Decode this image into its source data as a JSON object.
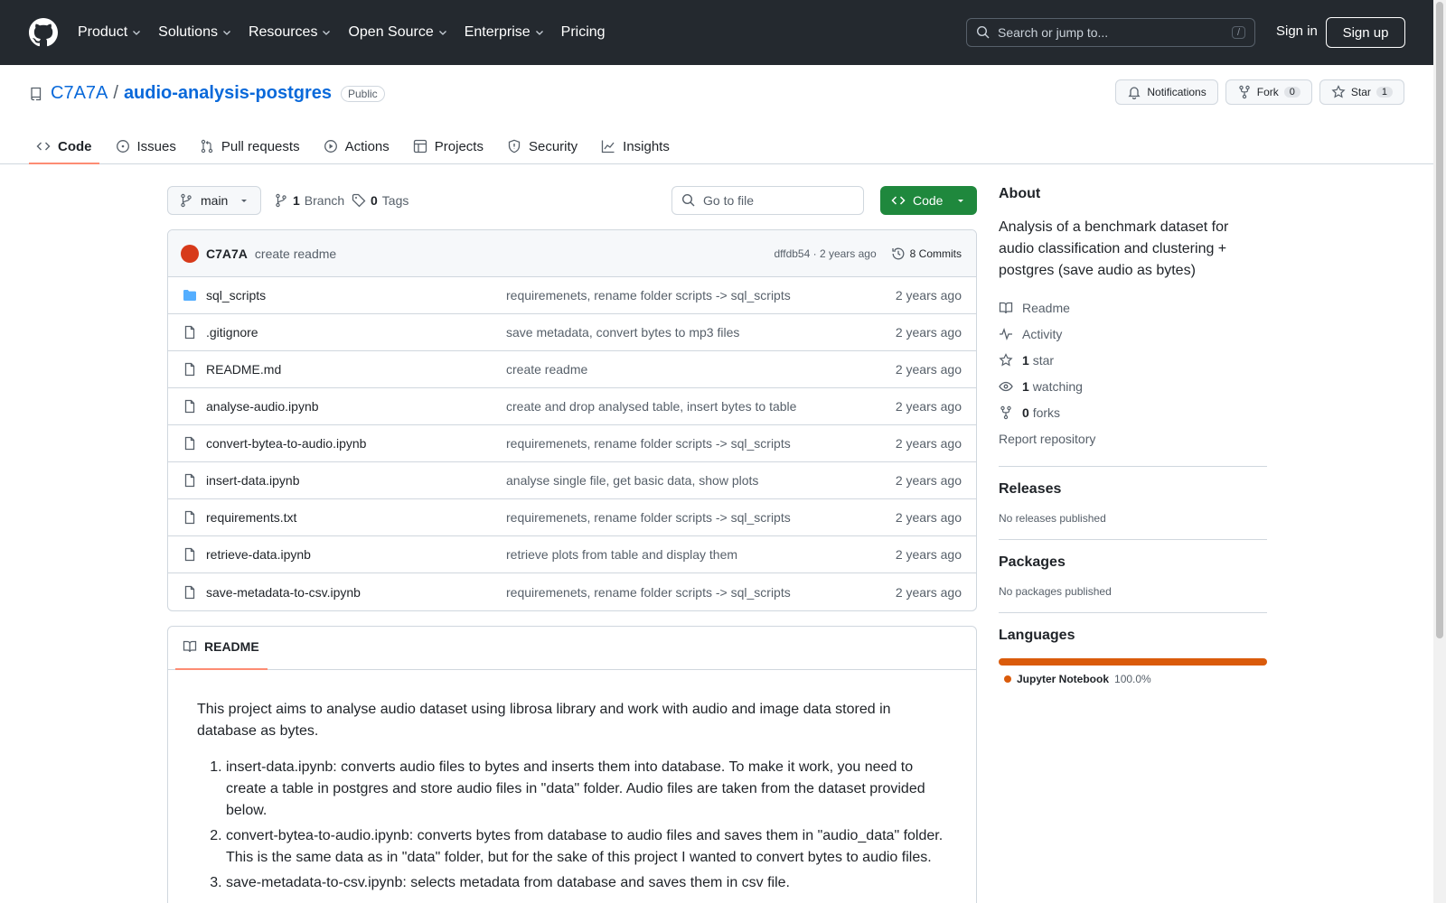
{
  "header": {
    "nav": [
      "Product",
      "Solutions",
      "Resources",
      "Open Source",
      "Enterprise",
      "Pricing"
    ],
    "search_placeholder": "Search or jump to...",
    "search_hint": "/",
    "signin": "Sign in",
    "signup": "Sign up"
  },
  "repo": {
    "owner": "C7A7A",
    "separator": "/",
    "name": "audio-analysis-postgres",
    "visibility": "Public",
    "notifications": "Notifications",
    "fork_label": "Fork",
    "fork_count": "0",
    "star_label": "Star",
    "star_count": "1"
  },
  "tabs": [
    "Code",
    "Issues",
    "Pull requests",
    "Actions",
    "Projects",
    "Security",
    "Insights"
  ],
  "branchbar": {
    "branch": "main",
    "branch_count": "1",
    "branch_label": "Branch",
    "tag_count": "0",
    "tag_label": "Tags",
    "gofile_placeholder": "Go to file",
    "code_label": "Code"
  },
  "commit": {
    "author": "C7A7A",
    "message": "create readme",
    "sha_time": "dffdb54 · 2 years ago",
    "commits": "8 Commits"
  },
  "files": [
    {
      "name": "sql_scripts",
      "type": "folder",
      "message": "requiremenets, rename folder scripts -> sql_scripts",
      "date": "2 years ago"
    },
    {
      "name": ".gitignore",
      "type": "file",
      "message": "save metadata, convert bytes to mp3 files",
      "date": "2 years ago"
    },
    {
      "name": "README.md",
      "type": "file",
      "message": "create readme",
      "date": "2 years ago"
    },
    {
      "name": "analyse-audio.ipynb",
      "type": "file",
      "message": "create and drop analysed table, insert bytes to table",
      "date": "2 years ago"
    },
    {
      "name": "convert-bytea-to-audio.ipynb",
      "type": "file",
      "message": "requiremenets, rename folder scripts -> sql_scripts",
      "date": "2 years ago"
    },
    {
      "name": "insert-data.ipynb",
      "type": "file",
      "message": "analyse single file, get basic data, show plots",
      "date": "2 years ago"
    },
    {
      "name": "requirements.txt",
      "type": "file",
      "message": "requiremenets, rename folder scripts -> sql_scripts",
      "date": "2 years ago"
    },
    {
      "name": "retrieve-data.ipynb",
      "type": "file",
      "message": "retrieve plots from table and display them",
      "date": "2 years ago"
    },
    {
      "name": "save-metadata-to-csv.ipynb",
      "type": "file",
      "message": "requiremenets, rename folder scripts -> sql_scripts",
      "date": "2 years ago"
    }
  ],
  "readme": {
    "tab": "README",
    "intro": "This project aims to analyse audio dataset using librosa library and work with audio and image data stored in database as bytes.",
    "items": [
      "insert-data.ipynb: converts audio files to bytes and inserts them into database. To make it work, you need to create a table in postgres and store audio files in \"data\" folder. Audio files are taken from the dataset provided below.",
      "convert-bytea-to-audio.ipynb: converts bytes from database to audio files and saves them in \"audio_data\" folder. This is the same data as in \"data\" folder, but for the sake of this project I wanted to convert bytes to audio files.",
      "save-metadata-to-csv.ipynb: selects metadata from database and saves them in csv file."
    ]
  },
  "sidebar": {
    "about_title": "About",
    "about_text": "Analysis of a benchmark dataset for audio classification and clustering + postgres (save audio as bytes)",
    "readme": "Readme",
    "activity": "Activity",
    "stars_count": "1",
    "stars_label": "star",
    "watching_count": "1",
    "watching_label": "watching",
    "forks_count": "0",
    "forks_label": "forks",
    "report": "Report repository",
    "releases_title": "Releases",
    "releases_text": "No releases published",
    "packages_title": "Packages",
    "packages_text": "No packages published",
    "languages_title": "Languages",
    "language_name": "Jupyter Notebook",
    "language_pct": "100.0%"
  }
}
